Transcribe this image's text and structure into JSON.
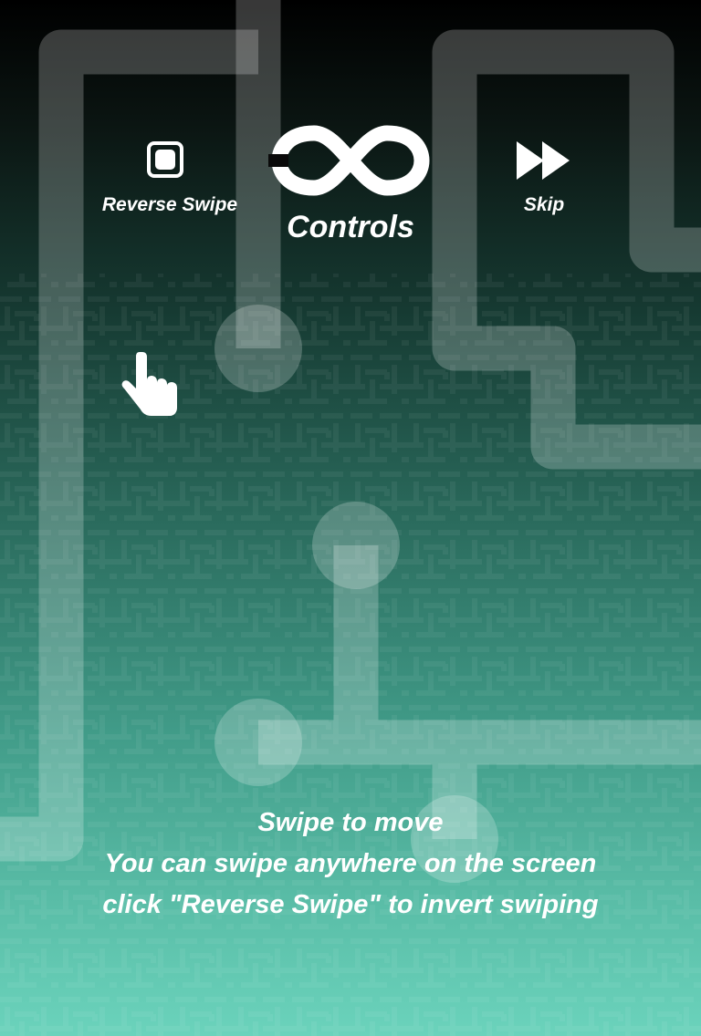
{
  "header": {
    "title": "Controls",
    "logo_icon": "infinity-icon"
  },
  "buttons": {
    "reverse_swipe": {
      "label": "Reverse Swipe",
      "icon": "stop-square-icon"
    },
    "skip": {
      "label": "Skip",
      "icon": "fast-forward-icon"
    }
  },
  "instructions": {
    "line1": "Swipe to move",
    "line2": "You can swipe anywhere on the screen",
    "line3": "click \"Reverse Swipe\" to invert swiping"
  },
  "hint": {
    "icon": "pointing-hand-icon"
  },
  "colors": {
    "gradient_top": "#000000",
    "gradient_bottom": "#6bd3bc",
    "pipe": "#ffffff",
    "text": "#ffffff"
  }
}
